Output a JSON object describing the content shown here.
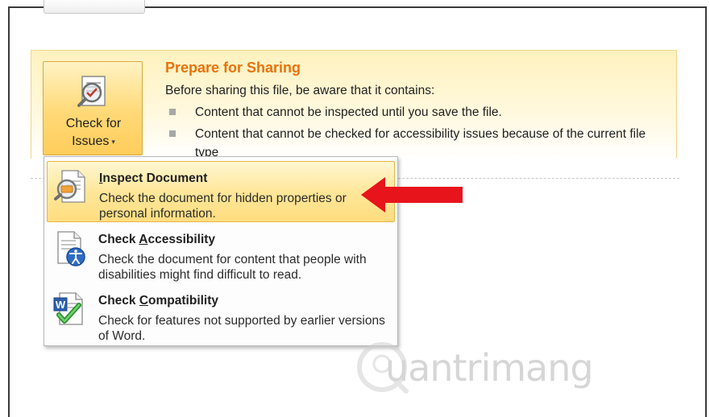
{
  "backstage": {
    "check_for_issues": {
      "line1": "Check for",
      "line2": "Issues",
      "caret": "▾",
      "icon": "inspect-document-icon"
    },
    "prepare": {
      "title": "Prepare for Sharing",
      "description": "Before sharing this file, be aware that it contains:",
      "bullets": [
        "Content that cannot be inspected until you save the file.",
        "Content that cannot be checked for accessibility issues because of the current file type"
      ]
    }
  },
  "menu": {
    "items": [
      {
        "title_pre": "",
        "title_acc": "I",
        "title_post": "nspect Document",
        "desc": "Check the document for hidden properties or personal information.",
        "icon": "inspect-document-icon",
        "highlighted": true
      },
      {
        "title_pre": "Check ",
        "title_acc": "A",
        "title_post": "ccessibility",
        "desc": "Check the document for content that people with disabilities might find difficult to read.",
        "icon": "accessibility-icon",
        "highlighted": false
      },
      {
        "title_pre": "Check ",
        "title_acc": "C",
        "title_post": "ompatibility",
        "desc": "Check for features not supported by earlier versions of Word.",
        "icon": "word-compatibility-icon",
        "highlighted": false
      }
    ]
  },
  "annotation": {
    "arrow_color": "#e8141b"
  },
  "watermark": {
    "text": "uantrimang"
  },
  "colors": {
    "title_orange": "#e8720c",
    "highlight_border": "#e6b646",
    "panel_bg": "#fff2bf"
  }
}
